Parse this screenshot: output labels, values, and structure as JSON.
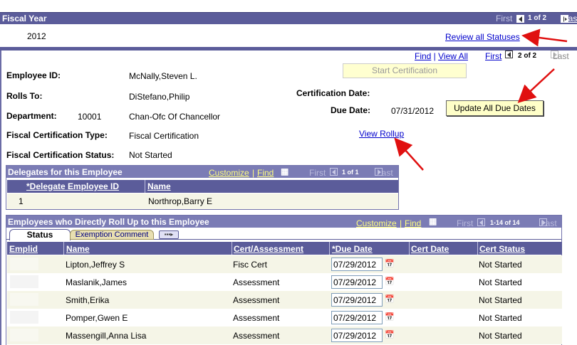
{
  "fiscal_year": {
    "section_title": "Fiscal Year",
    "value": "2012",
    "nav_first": "First",
    "nav_count": "1 of 2",
    "nav_last": "Las",
    "review_link": "Review all Statuses"
  },
  "main_nav": {
    "find": "Find",
    "view_all": "View All",
    "first": "First",
    "count": "2 of 2",
    "last": "Last"
  },
  "employee": {
    "id_label": "Employee ID:",
    "id_value": "McNally,Steven L.",
    "rolls_to_label": "Rolls To:",
    "rolls_to_value": "DiStefano,Philip",
    "department_label": "Department:",
    "department_code": "10001",
    "department_name": "Chan-Ofc Of Chancellor",
    "cert_type_label": "Fiscal Certification Type:",
    "cert_type_value": "Fiscal Certification",
    "cert_status_label": "Fiscal Certification Status:",
    "cert_status_value": "Not Started",
    "cert_date_label": "Certification Date:",
    "due_date_label": "Due Date:",
    "due_date_value": "07/31/2012"
  },
  "buttons": {
    "start_certification": "Start Certification",
    "update_due_dates": "Update All Due Dates",
    "view_rollup": "View Rollup"
  },
  "delegates": {
    "title": "Delegates for this Employee",
    "customize": "Customize",
    "find": "Find",
    "first": "First",
    "count": "1 of 1",
    "last": "Last",
    "col_id": "*Delegate Employee ID",
    "col_name": "Name",
    "rows": [
      {
        "num": "1",
        "name": "Northrop,Barry E"
      }
    ]
  },
  "rollup": {
    "title": "Employees who Directly Roll Up to this Employee",
    "customize": "Customize",
    "find": "Find",
    "first": "First",
    "count": "1-14 of 14",
    "last": "Last",
    "tabs": {
      "status": "Status",
      "exemption": "Exemption Comment"
    },
    "columns": {
      "emplid": "Emplid",
      "name": "Name",
      "cert": "Cert/Assessment",
      "due": "*Due Date",
      "cert_date": "Cert Date",
      "cert_status": "Cert Status"
    },
    "rows": [
      {
        "name": "Lipton,Jeffrey S",
        "cert": "Fisc Cert",
        "due": "07/29/2012",
        "status": "Not Started"
      },
      {
        "name": "Maslanik,James",
        "cert": "Assessment",
        "due": "07/29/2012",
        "status": "Not Started"
      },
      {
        "name": "Smith,Erika",
        "cert": "Assessment",
        "due": "07/29/2012",
        "status": "Not Started"
      },
      {
        "name": "Pomper,Gwen E",
        "cert": "Assessment",
        "due": "07/29/2012",
        "status": "Not Started"
      },
      {
        "name": "Massengill,Anna Lisa",
        "cert": "Assessment",
        "due": "07/29/2012",
        "status": "Not Started"
      }
    ]
  },
  "colors": {
    "header_bar": "#5b5c9a",
    "grid_header": "#7b7cb5",
    "button_bg": "#ffffc8",
    "annotation_arrow": "#e01010"
  },
  "icons": {
    "calendar": "calendar-icon",
    "grid_view": "grid-view-icon",
    "expand_tabs": "expand-tabs-icon"
  }
}
